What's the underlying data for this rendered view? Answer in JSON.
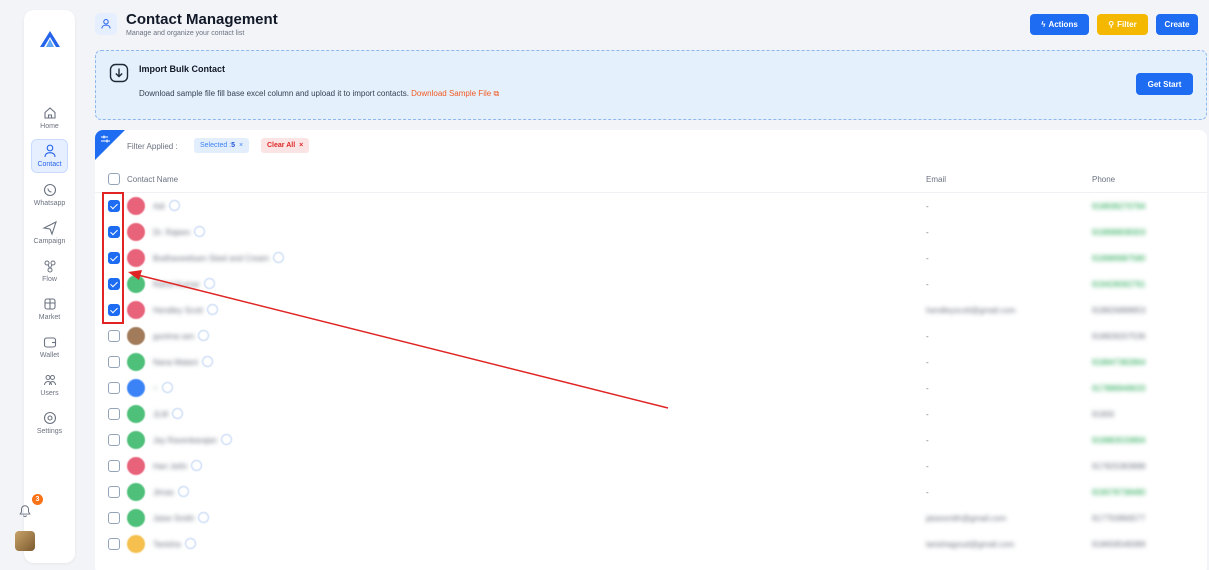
{
  "sidebar": {
    "items": [
      {
        "label": "Home",
        "icon": "home-icon"
      },
      {
        "label": "Contact",
        "icon": "contact-icon",
        "active": true
      },
      {
        "label": "Whatsapp",
        "icon": "whatsapp-icon"
      },
      {
        "label": "Campaign",
        "icon": "send-icon"
      },
      {
        "label": "Flow",
        "icon": "flow-icon"
      },
      {
        "label": "Market",
        "icon": "market-icon"
      },
      {
        "label": "Wallet",
        "icon": "wallet-icon"
      },
      {
        "label": "Users",
        "icon": "users-icon"
      },
      {
        "label": "Settings",
        "icon": "settings-icon"
      }
    ],
    "notification_count": "3"
  },
  "header": {
    "title": "Contact Management",
    "subtitle": "Manage and organize your contact list",
    "actions_label": "Actions",
    "filter_label": "Filter",
    "create_label": "Create"
  },
  "banner": {
    "title": "Import Bulk Contact",
    "description": "Download sample file fill base excel column and upload it to import contacts.",
    "link_label": "Download Sample File",
    "button_label": "Get Start"
  },
  "filters": {
    "label": "Filter Applied :",
    "selected_label": "Selected :",
    "selected_count": "5",
    "clear_label": "Clear All"
  },
  "table": {
    "columns": [
      "Contact Name",
      "Email",
      "Phone"
    ],
    "rows": [
      {
        "checked": true,
        "avatar_color": "#e8637a",
        "name": "Adi",
        "email": "-",
        "phone": "918838270794",
        "phone_color": "green"
      },
      {
        "checked": true,
        "avatar_color": "#e8637a",
        "name": "Dr. Rajeev",
        "email": "-",
        "phone": "919898838303",
        "phone_color": "green"
      },
      {
        "checked": true,
        "avatar_color": "#e8637a",
        "name": "Bodhaveettuen Steel and Cream",
        "email": "-",
        "phone": "918989987580",
        "phone_color": "green"
      },
      {
        "checked": true,
        "avatar_color": "#4ec07a",
        "name": "Rahul Kumar",
        "email": "-",
        "phone": "919428092791",
        "phone_color": "green"
      },
      {
        "checked": true,
        "avatar_color": "#e8637a",
        "name": "Hendley Scott",
        "email": "hendleyscott@gmail.com",
        "phone": "918826888853",
        "phone_color": "gray",
        "email_blur": true
      },
      {
        "checked": false,
        "avatar_color": "#a17b5a",
        "name": "gunima sen",
        "email": "-",
        "phone": "918828207536",
        "phone_color": "gray"
      },
      {
        "checked": false,
        "avatar_color": "#4ec07a",
        "name": "Nana Malani",
        "email": "-",
        "phone": "918847382864",
        "phone_color": "green"
      },
      {
        "checked": false,
        "avatar_color": "#3b82f6",
        "name": "~",
        "email": "-",
        "phone": "917888948633",
        "phone_color": "green"
      },
      {
        "checked": false,
        "avatar_color": "#4ec07a",
        "name": "JLM",
        "email": "-",
        "phone": "91900",
        "phone_color": "gray"
      },
      {
        "checked": false,
        "avatar_color": "#4ec07a",
        "name": "Jay Ravenkarajan",
        "email": "-",
        "phone": "919883533894",
        "phone_color": "green"
      },
      {
        "checked": false,
        "avatar_color": "#e8637a",
        "name": "Hari Jethi",
        "email": "-",
        "phone": "917825383888",
        "phone_color": "gray"
      },
      {
        "checked": false,
        "avatar_color": "#4ec07a",
        "name": "Jimas",
        "email": "-",
        "phone": "919078738480",
        "phone_color": "green"
      },
      {
        "checked": false,
        "avatar_color": "#4ec07a",
        "name": "Jaise Smith",
        "email": "jaisesmith@gmail.com",
        "phone": "917750866577",
        "phone_color": "gray",
        "email_blur": true
      },
      {
        "checked": false,
        "avatar_color": "#f5c04e",
        "name": "Tanisha",
        "email": "tanishagoud@gmail.com",
        "phone": "918658548389",
        "phone_color": "gray",
        "email_blur": true
      }
    ]
  },
  "colors": {
    "primary": "#1d6cf2",
    "warning": "#f5b800",
    "link": "#f05a22",
    "annotation": "#e02424"
  }
}
